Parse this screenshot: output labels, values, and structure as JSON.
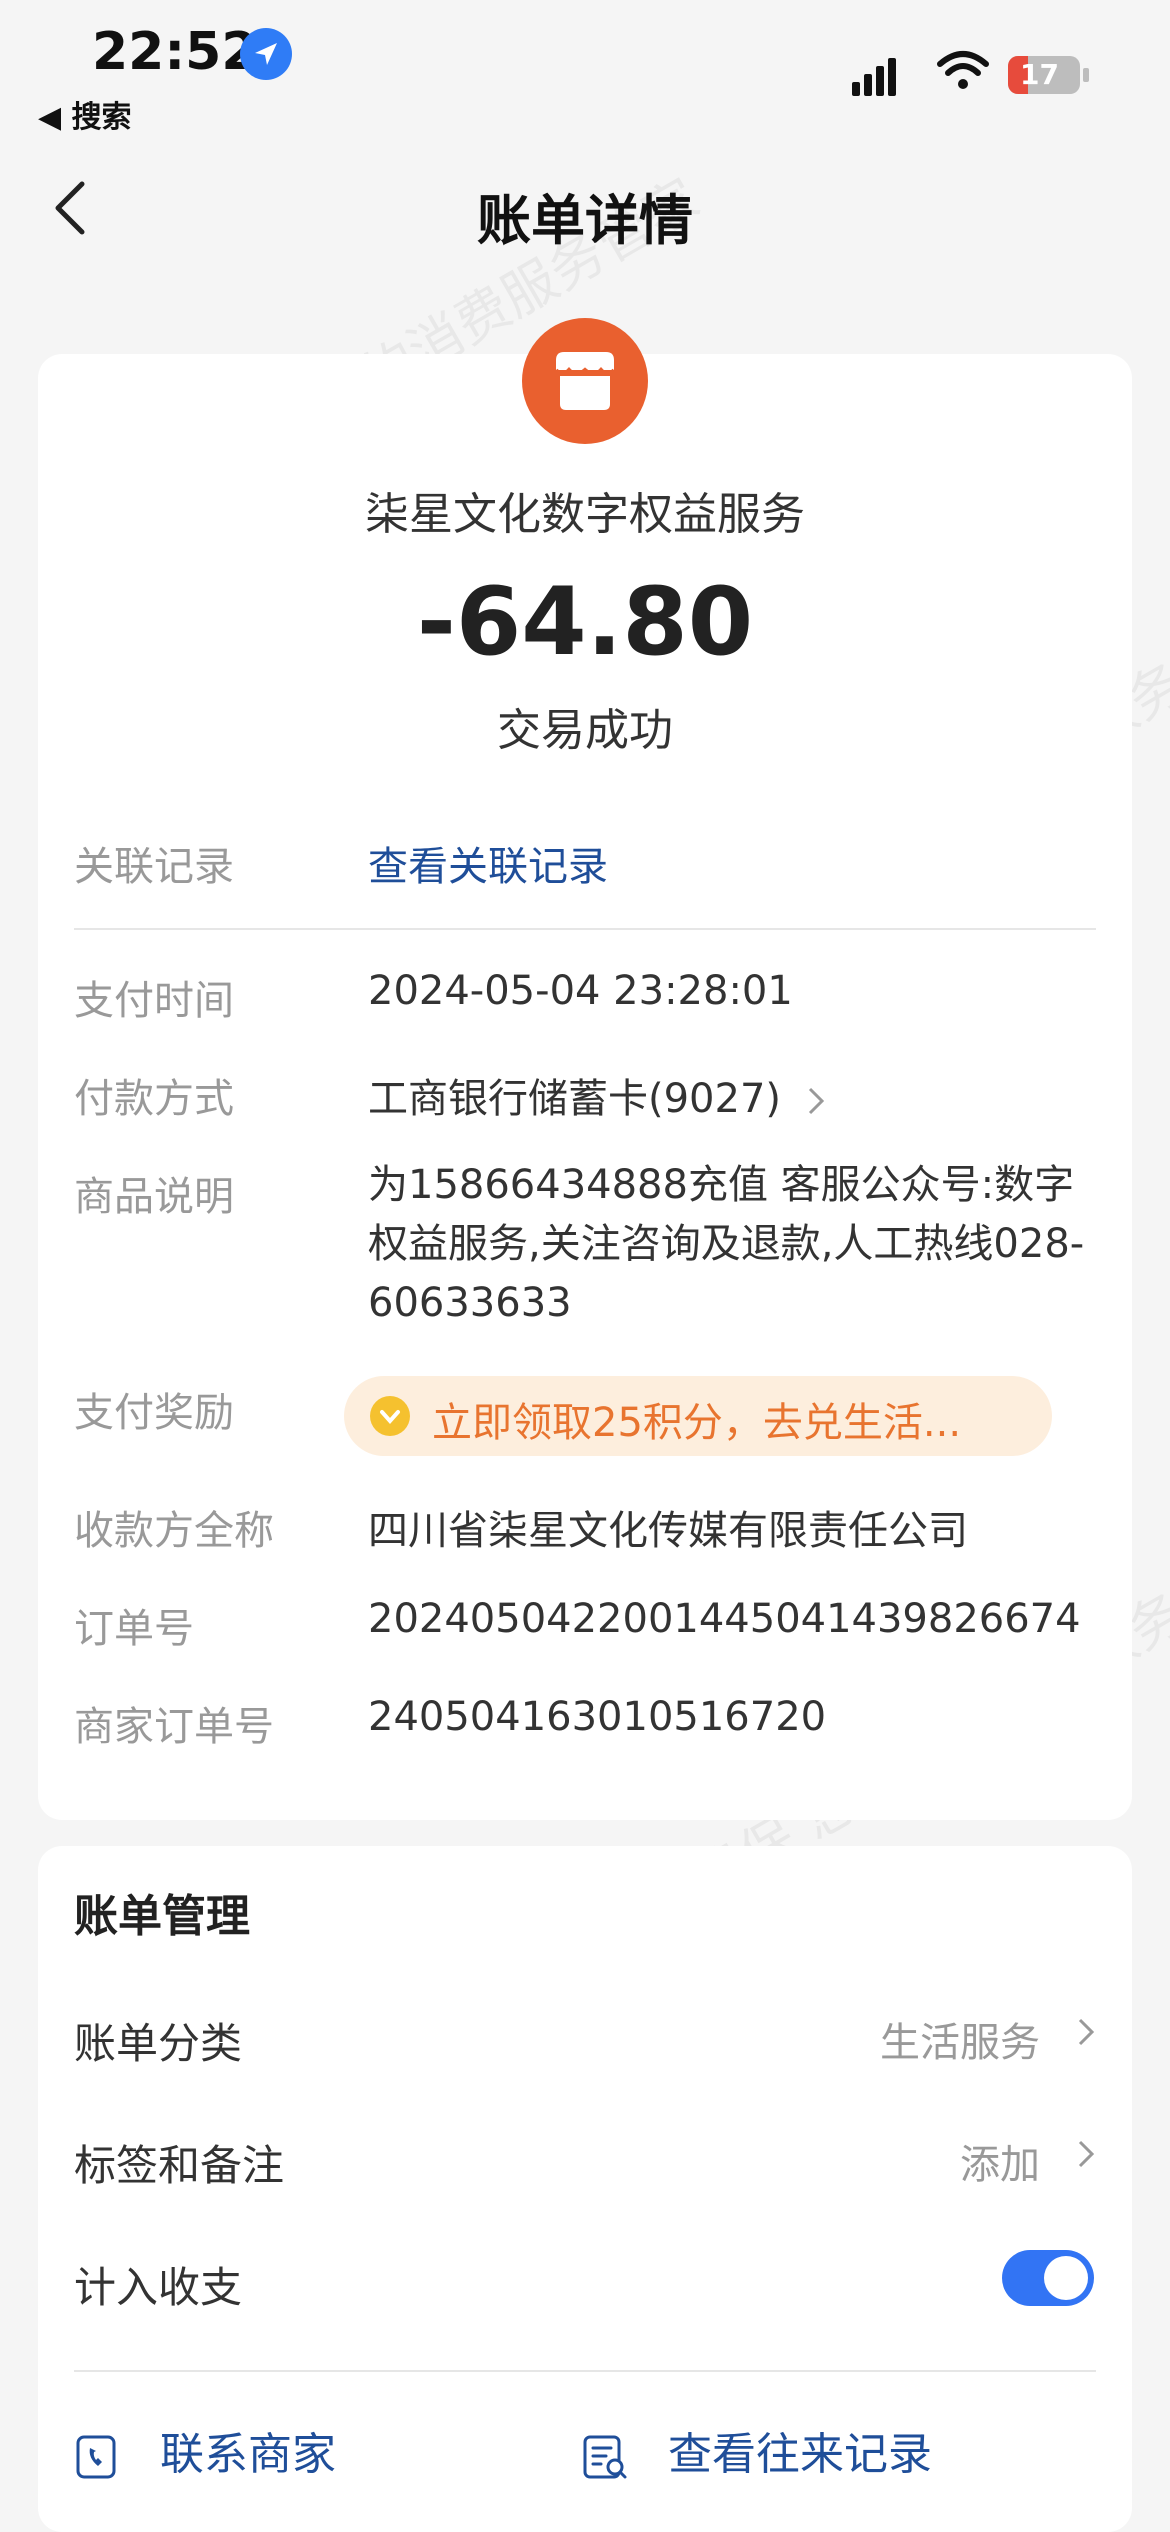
{
  "status_bar": {
    "time": "22:52",
    "back_app": "◀ 搜索",
    "battery": "17"
  },
  "nav": {
    "title": "账单详情"
  },
  "bill": {
    "merchant": "柒星文化数字权益服务",
    "amount": "-64.80",
    "status": "交易成功",
    "rows": {
      "related_label": "关联记录",
      "related_value": "查看关联记录",
      "time_label": "支付时间",
      "time_value": "2024-05-04 23:28:01",
      "method_label": "付款方式",
      "method_value": "工商银行储蓄卡(9027)",
      "desc_label": "商品说明",
      "desc_value": "为15866434888充值 客服公众号:数字权益服务,关注咨询及退款,人工热线028-60633633",
      "reward_label": "支付奖励",
      "reward_value": "立即领取25积分，去兑生活...",
      "payee_label": "收款方全称",
      "payee_value": "四川省柒星文化传媒有限责任公司",
      "order_label": "订单号",
      "order_value": "2024050422001445041439826674",
      "merchant_order_label": "商家订单号",
      "merchant_order_value": "240504163010516720"
    }
  },
  "manage": {
    "title": "账单管理",
    "category_label": "账单分类",
    "category_value": "生活服务",
    "tags_label": "标签和备注",
    "tags_value": "添加",
    "count_label": "计入收支",
    "count_enabled": true,
    "contact_label": "联系商家",
    "history_label": "查看往来记录"
  },
  "watermark": "消费保 您身边的消费服务管家",
  "colors": {
    "accent_blue": "#3274f4",
    "link_blue": "#1f4e99",
    "merchant_orange": "#e9602f",
    "reward_text": "#e8742f"
  }
}
